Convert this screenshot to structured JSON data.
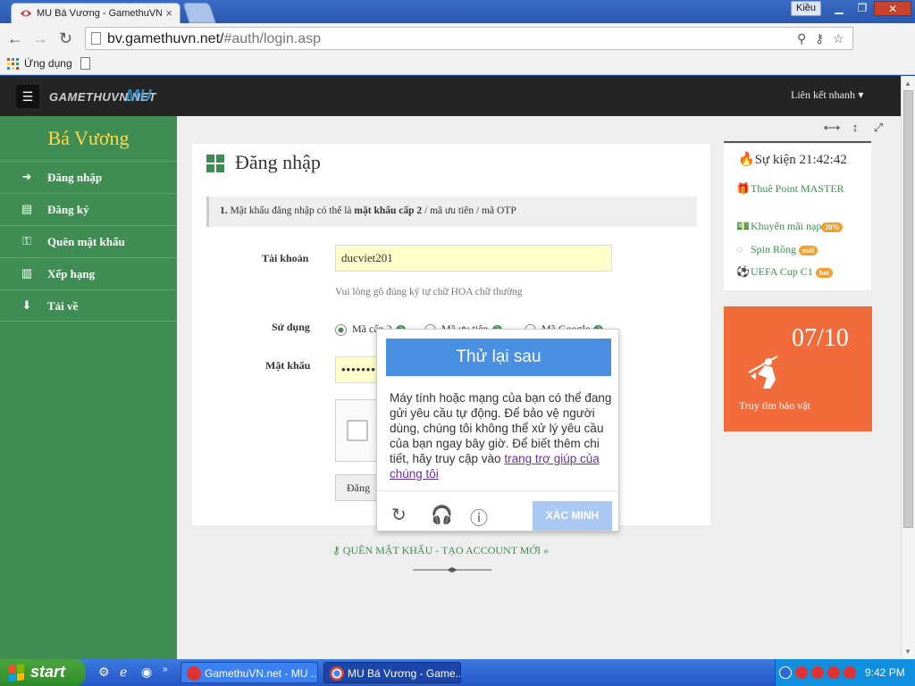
{
  "browser": {
    "tab_title": "MU Bá Vương - GamethuVN.n",
    "user_label": "Kiều",
    "url_host": "bv.gamethuvn.net/",
    "url_path": "#auth/login.asp",
    "apps_label": "Ứng dụng"
  },
  "header": {
    "logo_text": "GAMETHUVN.NET",
    "logo_mark": "MU",
    "quick_links": "Liên kết nhanh"
  },
  "sidebar": {
    "site_name": "Bá Vương",
    "items": [
      {
        "label": "Đăng nhập",
        "icon": "sign-in-icon"
      },
      {
        "label": "Đăng ký",
        "icon": "document-icon"
      },
      {
        "label": "Quên mật khẩu",
        "icon": "key-icon"
      },
      {
        "label": "Xếp hạng",
        "icon": "bar-chart-icon"
      },
      {
        "label": "Tải về",
        "icon": "download-icon"
      }
    ]
  },
  "login": {
    "title": "Đăng nhập",
    "notice_num": "1.",
    "notice_pre": " Mật khẩu đăng nhập có thể là ",
    "notice_bold": "mật khẩu cấp 2",
    "notice_post": " / mã ưu tiên / mã OTP",
    "account_label": "Tài khoản",
    "account_value": "ducviet201",
    "account_hint": "Vui lòng gõ đúng ký tự chữ HOA chữ thường",
    "use_label": "Sử dụng",
    "options": [
      "Mã cấp 2",
      "Mã ưu tiên",
      "Mã Google"
    ],
    "password_label": "Mật khẩu",
    "password_value": "••••••••",
    "submit_label": "Đăng"
  },
  "links": {
    "forgot": "QUÊN MẬT KHẨU - TẠO ACCOUNT MỚI »"
  },
  "events": {
    "title": "Sự kiện 21:42:42",
    "items": [
      {
        "label": "Thuê Point MASTER",
        "badge": ""
      },
      {
        "label": "Khuyến mãi nạp",
        "badge": "20%"
      },
      {
        "label": "Spin Rồng",
        "badge": "mới"
      },
      {
        "label": "UEFA Cup C1",
        "badge": "hot"
      }
    ]
  },
  "treasure": {
    "date": "07/10",
    "label": "Truy tìm bảo vật"
  },
  "recaptcha": {
    "header": "Thử lại sau",
    "body": "Máy tính hoặc mạng của bạn có thể đang gửi yêu cầu tự động. Để bảo vệ người dùng, chúng tôi không thể xử lý yêu cầu của bạn ngay bây giờ. Để biết thêm chi tiết, hãy truy cập vào ",
    "link": "trang trợ giúp của chúng tôi",
    "verify": "XÁC MINH"
  },
  "taskbar": {
    "start": "start",
    "task1": "GamethuVN.net - MU ...",
    "task2": "MU Bá Vương - Game...",
    "clock": "9:42 PM"
  },
  "colors": {
    "accent_green": "#3f8d52",
    "site_name": "#ffd84a",
    "treasure_orange": "#f26c3b",
    "recaptcha_blue": "#4a90e2"
  }
}
